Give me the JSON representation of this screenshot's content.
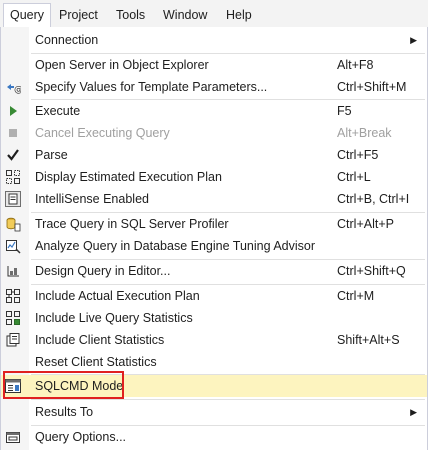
{
  "menubar": {
    "items": [
      {
        "label": "Query"
      },
      {
        "label": "Project"
      },
      {
        "label": "Tools"
      },
      {
        "label": "Window"
      },
      {
        "label": "Help"
      }
    ]
  },
  "menu": {
    "items": [
      {
        "label": "Connection",
        "shortcut": "",
        "submenu": true,
        "icon": "none"
      },
      {
        "label": "Open Server in Object Explorer",
        "shortcut": "Alt+F8",
        "icon": "none"
      },
      {
        "label": "Specify Values for Template Parameters...",
        "shortcut": "Ctrl+Shift+M",
        "icon": "template-parameters-icon"
      },
      {
        "label": "Execute",
        "shortcut": "F5",
        "icon": "play-icon"
      },
      {
        "label": "Cancel Executing Query",
        "shortcut": "Alt+Break",
        "icon": "stop-icon",
        "disabled": true
      },
      {
        "label": "Parse",
        "shortcut": "Ctrl+F5",
        "icon": "checkmark-icon"
      },
      {
        "label": "Display Estimated Execution Plan",
        "shortcut": "Ctrl+L",
        "icon": "execution-plan-icon"
      },
      {
        "label": "IntelliSense Enabled",
        "shortcut": "Ctrl+B, Ctrl+I",
        "icon": "intellisense-icon"
      },
      {
        "label": "Trace Query in SQL Server Profiler",
        "shortcut": "Ctrl+Alt+P",
        "icon": "profiler-icon"
      },
      {
        "label": "Analyze Query in Database Engine Tuning Advisor",
        "shortcut": "",
        "icon": "tuning-advisor-icon"
      },
      {
        "label": "Design Query in Editor...",
        "shortcut": "Ctrl+Shift+Q",
        "icon": "query-designer-icon"
      },
      {
        "label": "Include Actual Execution Plan",
        "shortcut": "Ctrl+M",
        "icon": "actual-plan-icon"
      },
      {
        "label": "Include Live Query Statistics",
        "shortcut": "",
        "icon": "live-stats-icon"
      },
      {
        "label": "Include Client Statistics",
        "shortcut": "Shift+Alt+S",
        "icon": "client-stats-icon"
      },
      {
        "label": "Reset Client Statistics",
        "shortcut": "",
        "icon": "none"
      },
      {
        "label": "SQLCMD Mode",
        "shortcut": "",
        "icon": "sqlcmd-icon",
        "highlighted": true
      },
      {
        "label": "Results To",
        "shortcut": "",
        "submenu": true,
        "icon": "none"
      },
      {
        "label": "Query Options...",
        "shortcut": "",
        "icon": "query-options-icon"
      }
    ]
  },
  "colors": {
    "highlight_bg": "#fdf4bf",
    "callout_border": "#e02020",
    "play_green": "#388a34",
    "disabled_text": "#a0a0a0"
  }
}
